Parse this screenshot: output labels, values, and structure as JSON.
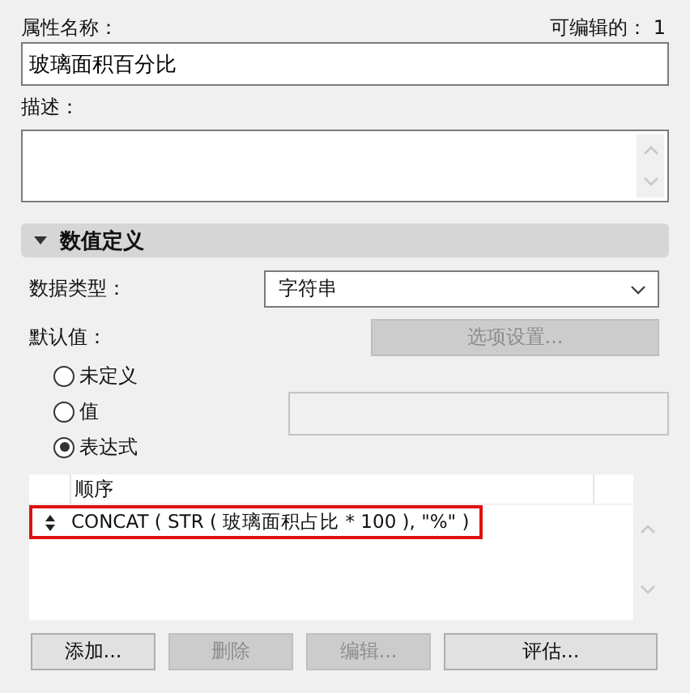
{
  "name_field": {
    "label": "属性名称：",
    "value": "玻璃面积百分比"
  },
  "editable_count": "可编辑的： 1",
  "description_field": {
    "label": "描述："
  },
  "section": {
    "title": "数值定义",
    "expanded": true
  },
  "data_type": {
    "label": "数据类型：",
    "value": "字符串"
  },
  "default_value": {
    "label": "默认值：",
    "options_button": {
      "label": "选项设置...",
      "disabled": true
    }
  },
  "radios": [
    {
      "label": "未定义",
      "selected": false
    },
    {
      "label": "值",
      "selected": false
    },
    {
      "label": "表达式",
      "selected": true
    }
  ],
  "table": {
    "column_header": "顺序",
    "rows": [
      {
        "text": "CONCAT ( STR ( 玻璃面积占比 * 100 ), \"%\" )",
        "highlighted": true
      }
    ]
  },
  "buttons": [
    {
      "label": "添加...",
      "disabled": false
    },
    {
      "label": "删除",
      "disabled": true
    },
    {
      "label": "编辑...",
      "disabled": true
    },
    {
      "label": "评估...",
      "disabled": false
    }
  ]
}
